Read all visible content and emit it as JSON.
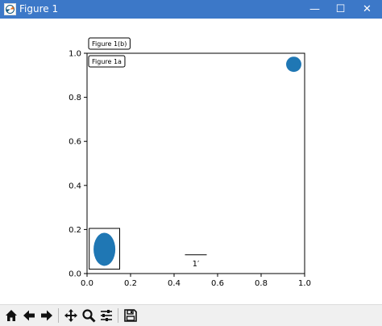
{
  "window": {
    "title": "Figure 1",
    "minimize_glyph": "—",
    "maximize_glyph": "☐",
    "close_glyph": "✕",
    "titlebar_color": "#3c78c8"
  },
  "chart_data": {
    "type": "scatter",
    "xlim": [
      0.0,
      1.0
    ],
    "ylim": [
      0.0,
      1.0
    ],
    "x_ticks": [
      "0.0",
      "0.2",
      "0.4",
      "0.6",
      "0.8",
      "1.0"
    ],
    "y_ticks": [
      "0.0",
      "0.2",
      "0.4",
      "0.6",
      "0.8",
      "1.0"
    ],
    "grid": false,
    "annotations": {
      "label_outside": "Figure 1(b)",
      "label_inside": "Figure 1a",
      "scalebar_label": "1′"
    },
    "artists": {
      "circle": {
        "center": [
          0.95,
          0.95
        ],
        "radius": 0.035,
        "color": "#1f77b4"
      },
      "ellipse": {
        "center": [
          0.08,
          0.11
        ],
        "width": 0.1,
        "height": 0.15,
        "color": "#1f77b4"
      },
      "ellipse_box": {
        "x": [
          0.01,
          0.15
        ],
        "y": [
          0.02,
          0.205
        ]
      },
      "scalebar": {
        "x": [
          0.45,
          0.55
        ],
        "y": 0.085
      }
    }
  },
  "toolbar": {
    "tools": [
      {
        "name": "home-icon",
        "tooltip": "Home"
      },
      {
        "name": "back-arrow-icon",
        "tooltip": "Back"
      },
      {
        "name": "forward-arrow-icon",
        "tooltip": "Forward"
      },
      {
        "name": "pan-move-icon",
        "tooltip": "Pan"
      },
      {
        "name": "zoom-magnifier-icon",
        "tooltip": "Zoom"
      },
      {
        "name": "configure-subplots-icon",
        "tooltip": "Subplots"
      },
      {
        "name": "save-disk-icon",
        "tooltip": "Save"
      }
    ]
  }
}
